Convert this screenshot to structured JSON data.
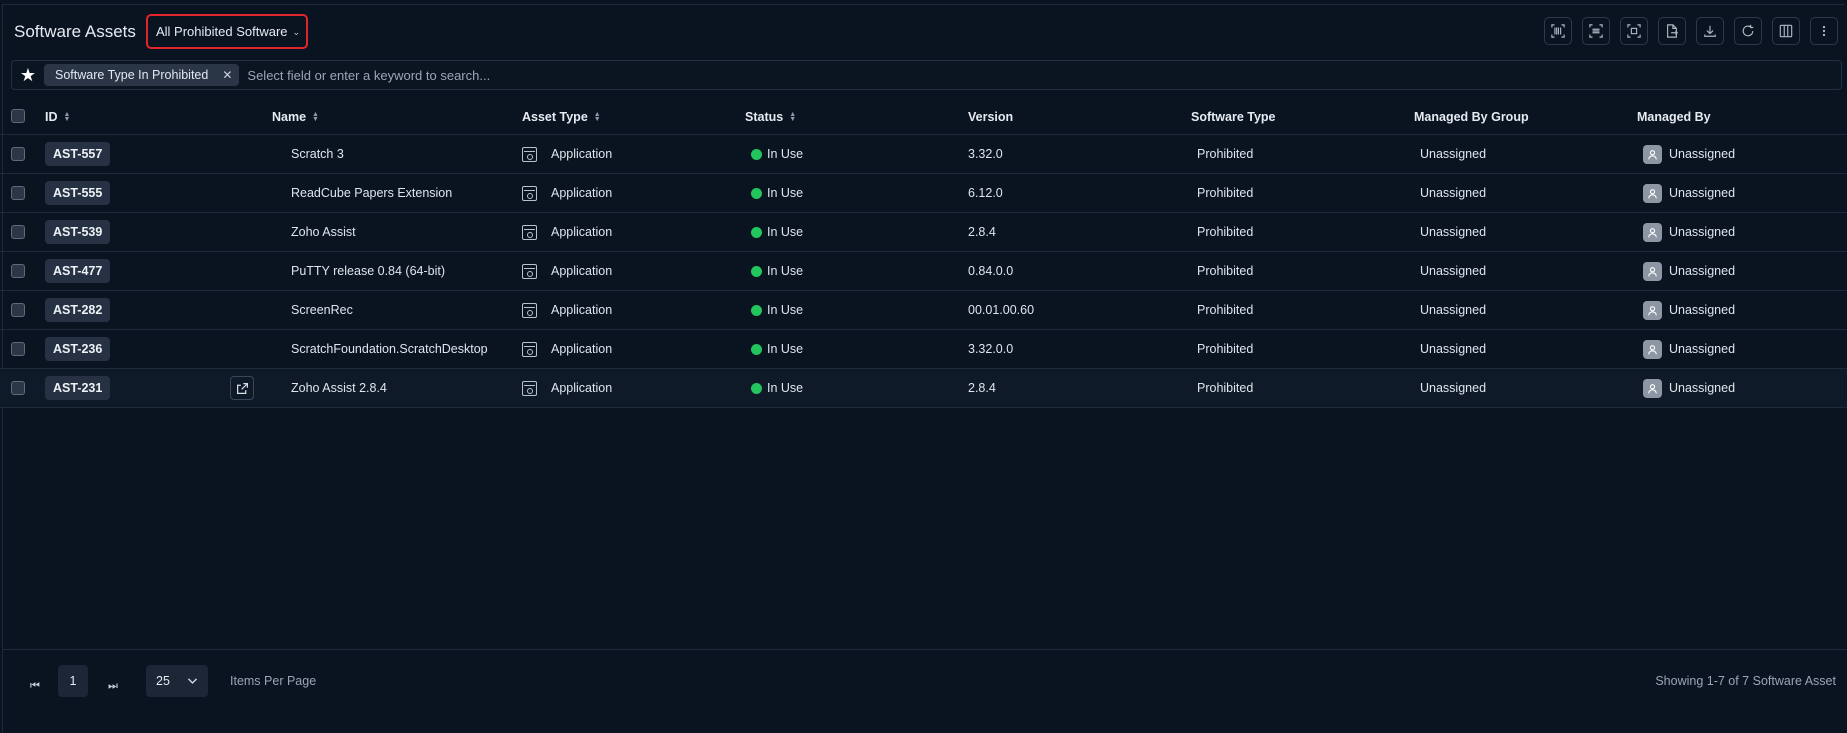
{
  "header": {
    "title": "Software Assets",
    "view_selector": "All Prohibited Software",
    "toolbar_icons": [
      "barcode-icon",
      "scan-icon",
      "qr-scan-icon",
      "export-file-icon",
      "download-icon",
      "refresh-icon",
      "columns-icon",
      "more-vertical-icon"
    ]
  },
  "filter": {
    "chip_label": "Software Type In Prohibited",
    "search_placeholder": "Select field or enter a keyword to search..."
  },
  "table": {
    "columns": [
      "ID",
      "Name",
      "Asset Type",
      "Status",
      "Version",
      "Software Type",
      "Managed By Group",
      "Managed By"
    ],
    "rows": [
      {
        "id": "AST-557",
        "name": "Scratch 3",
        "asset_type": "Application",
        "status": "In Use",
        "version": "3.32.0",
        "software_type": "Prohibited",
        "managed_by_group": "Unassigned",
        "managed_by": "Unassigned"
      },
      {
        "id": "AST-555",
        "name": "ReadCube Papers Extension",
        "asset_type": "Application",
        "status": "In Use",
        "version": "6.12.0",
        "software_type": "Prohibited",
        "managed_by_group": "Unassigned",
        "managed_by": "Unassigned"
      },
      {
        "id": "AST-539",
        "name": "Zoho Assist",
        "asset_type": "Application",
        "status": "In Use",
        "version": "2.8.4",
        "software_type": "Prohibited",
        "managed_by_group": "Unassigned",
        "managed_by": "Unassigned"
      },
      {
        "id": "AST-477",
        "name": "PuTTY release 0.84 (64-bit)",
        "asset_type": "Application",
        "status": "In Use",
        "version": "0.84.0.0",
        "software_type": "Prohibited",
        "managed_by_group": "Unassigned",
        "managed_by": "Unassigned"
      },
      {
        "id": "AST-282",
        "name": "ScreenRec",
        "asset_type": "Application",
        "status": "In Use",
        "version": "00.01.00.60",
        "software_type": "Prohibited",
        "managed_by_group": "Unassigned",
        "managed_by": "Unassigned"
      },
      {
        "id": "AST-236",
        "name": "ScratchFoundation.ScratchDesktop",
        "asset_type": "Application",
        "status": "In Use",
        "version": "3.32.0.0",
        "software_type": "Prohibited",
        "managed_by_group": "Unassigned",
        "managed_by": "Unassigned"
      },
      {
        "id": "AST-231",
        "name": "Zoho Assist 2.8.4",
        "asset_type": "Application",
        "status": "In Use",
        "version": "2.8.4",
        "software_type": "Prohibited",
        "managed_by_group": "Unassigned",
        "managed_by": "Unassigned"
      }
    ],
    "status_color": "#22c55e"
  },
  "footer": {
    "current_page": "1",
    "per_page": "25",
    "per_page_label": "Items Per Page",
    "summary": "Showing 1-7 of 7 Software Asset"
  }
}
